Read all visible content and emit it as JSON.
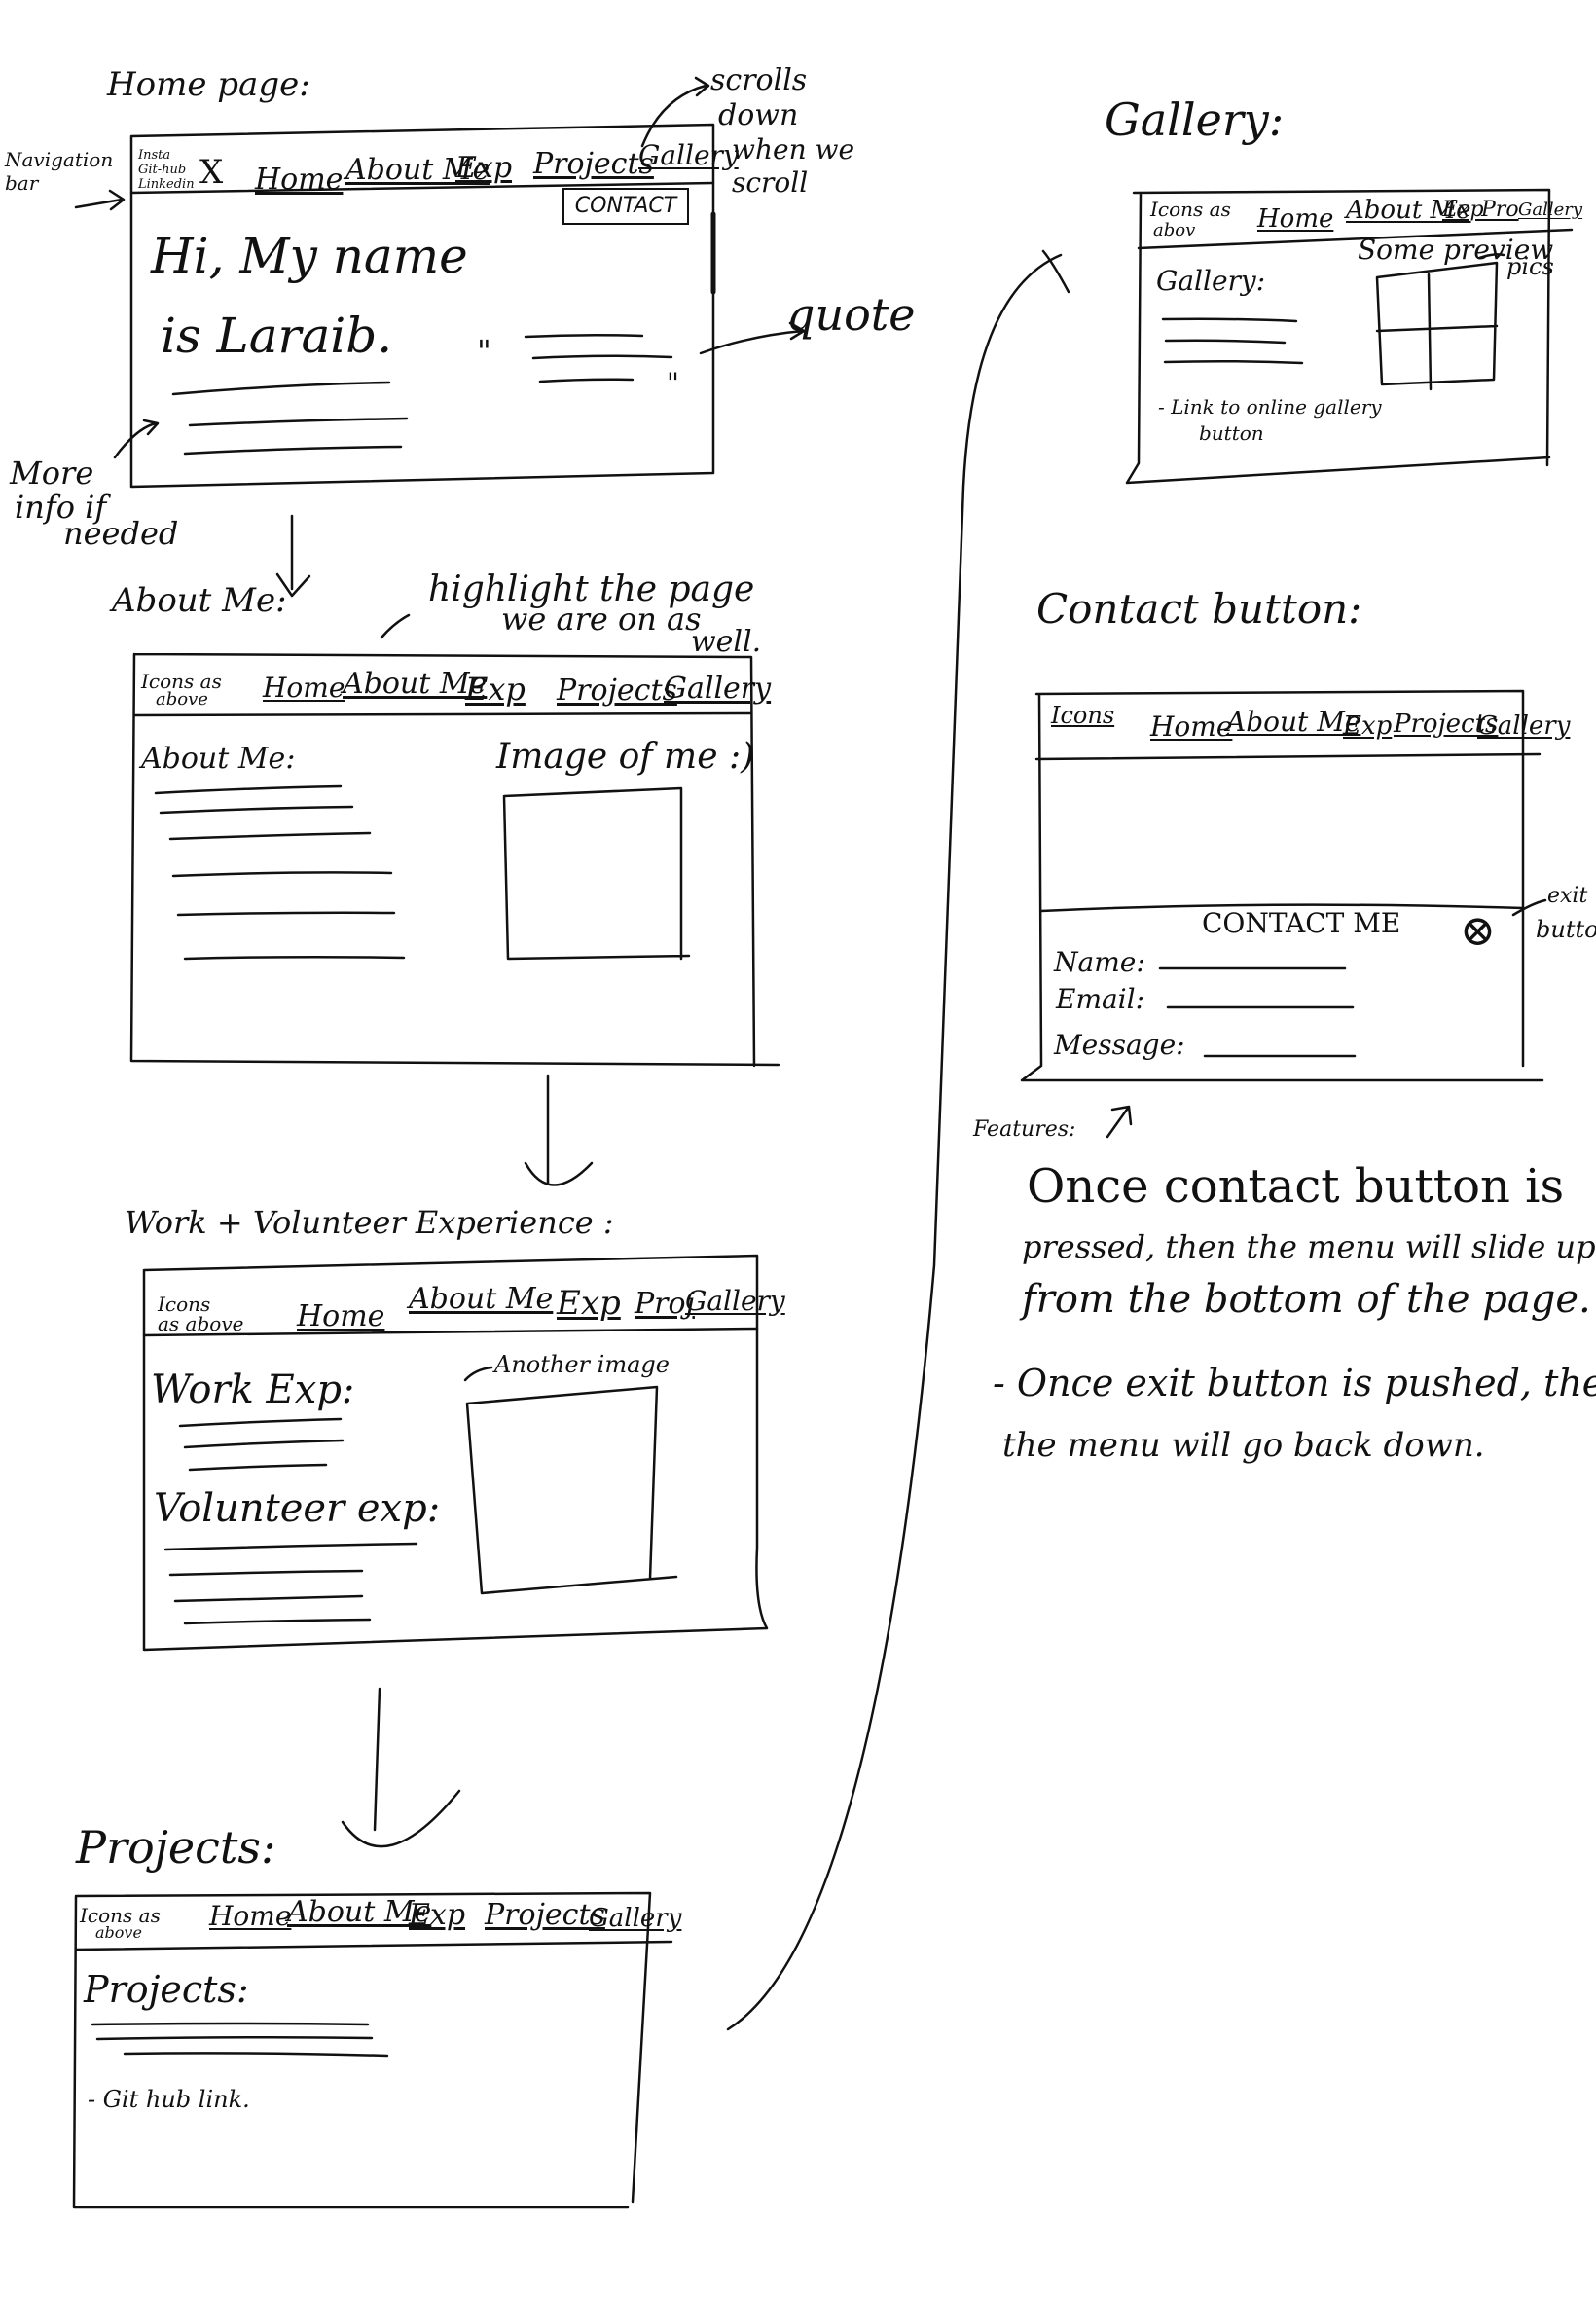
{
  "home": {
    "title": "Home page:",
    "navbar_label": "Navigation bar",
    "icons": [
      "Insta",
      "Git-hub",
      "Linkedin"
    ],
    "icon_close": "X",
    "nav": [
      "Home",
      "About Me",
      "Exp",
      "Projects",
      "Gallery"
    ],
    "contact_button": "CONTACT",
    "hero_line1": "Hi, My name",
    "hero_line2": "is Laraib.",
    "quote_open": "\"",
    "quote_close": "\"",
    "quote_note": "quote",
    "scroll_note": [
      "scrolls",
      "down",
      "when we",
      "scroll"
    ],
    "more_info_note": [
      "More",
      "info if",
      "needed"
    ]
  },
  "about": {
    "title": "About Me:",
    "highlight_note": [
      "highlight the page",
      "we are on as",
      "well."
    ],
    "icons_note": [
      "Icons as",
      "above"
    ],
    "nav": [
      "Home",
      "About Me",
      "Exp",
      "Projects",
      "Gallery"
    ],
    "heading": "About Me:",
    "image_label": "Image of me :)"
  },
  "experience": {
    "title": "Work + Volunteer Experience :",
    "icons_note": [
      "Icons",
      "as above"
    ],
    "nav": [
      "Home",
      "About Me",
      "Exp",
      "Proj",
      "Gallery"
    ],
    "work_heading": "Work Exp:",
    "volunteer_heading": "Volunteer exp:",
    "image_label": "Another image"
  },
  "projects": {
    "title": "Projects:",
    "icons_note": [
      "Icons as",
      "above"
    ],
    "nav": [
      "Home",
      "About Me",
      "Exp",
      "Projects",
      "Gallery"
    ],
    "heading": "Projects:",
    "link_note": "- Git hub link."
  },
  "gallery": {
    "title": "Gallery:",
    "icons_note": [
      "Icons as",
      "abov"
    ],
    "nav": [
      "Home",
      "About Me",
      "Exp",
      "Pro",
      "Gallery"
    ],
    "heading": "Gallery:",
    "preview_note": [
      "Some preview",
      "pics"
    ],
    "link_note": [
      "- Link to online gallery",
      "button"
    ]
  },
  "contact": {
    "title": "Contact button:",
    "icons_note": "Icons",
    "nav": [
      "Home",
      "About Me",
      "Exp",
      "Projects",
      "Gallery"
    ],
    "panel_title": "CONTACT ME",
    "exit_symbol": "⊗",
    "exit_note": [
      "exit",
      "button"
    ],
    "fields": [
      "Name:",
      "Email:",
      "Message:"
    ],
    "features_label": "Features:",
    "feature_1": [
      "Once contact button is",
      "pressed, then the menu will slide up",
      "from the bottom of the page."
    ],
    "feature_2": [
      "- Once exit button is pushed, then",
      "the menu will go back down."
    ]
  }
}
